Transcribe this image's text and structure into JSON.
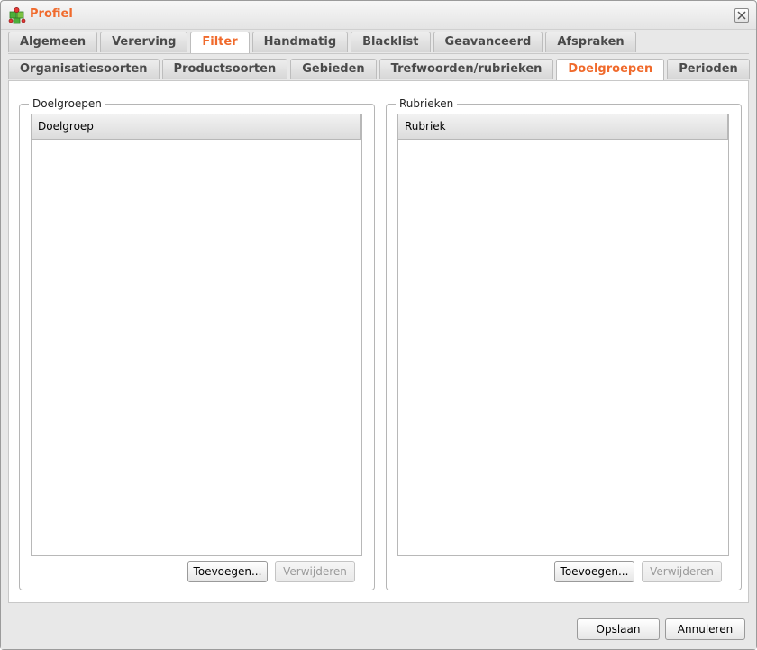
{
  "window": {
    "title": "Profiel",
    "icon": "puzzle-piece-icon",
    "accent_color": "#f06a2c"
  },
  "tabs_primary": [
    {
      "label": "Algemeen",
      "active": false
    },
    {
      "label": "Vererving",
      "active": false
    },
    {
      "label": "Filter",
      "active": true
    },
    {
      "label": "Handmatig",
      "active": false
    },
    {
      "label": "Blacklist",
      "active": false
    },
    {
      "label": "Geavanceerd",
      "active": false
    },
    {
      "label": "Afspraken",
      "active": false
    }
  ],
  "tabs_secondary": [
    {
      "label": "Organisatiesoorten",
      "active": false
    },
    {
      "label": "Productsoorten",
      "active": false
    },
    {
      "label": "Gebieden",
      "active": false
    },
    {
      "label": "Trefwoorden/rubrieken",
      "active": false
    },
    {
      "label": "Doelgroepen",
      "active": true
    },
    {
      "label": "Perioden",
      "active": false
    }
  ],
  "panels": {
    "left": {
      "legend": "Doelgroepen",
      "column_header": "Doelgroep",
      "rows": [],
      "add_label": "Toevoegen...",
      "remove_label": "Verwijderen",
      "remove_enabled": false
    },
    "right": {
      "legend": "Rubrieken",
      "column_header": "Rubriek",
      "rows": [],
      "add_label": "Toevoegen...",
      "remove_label": "Verwijderen",
      "remove_enabled": false
    }
  },
  "footer": {
    "save_label": "Opslaan",
    "cancel_label": "Annuleren"
  }
}
